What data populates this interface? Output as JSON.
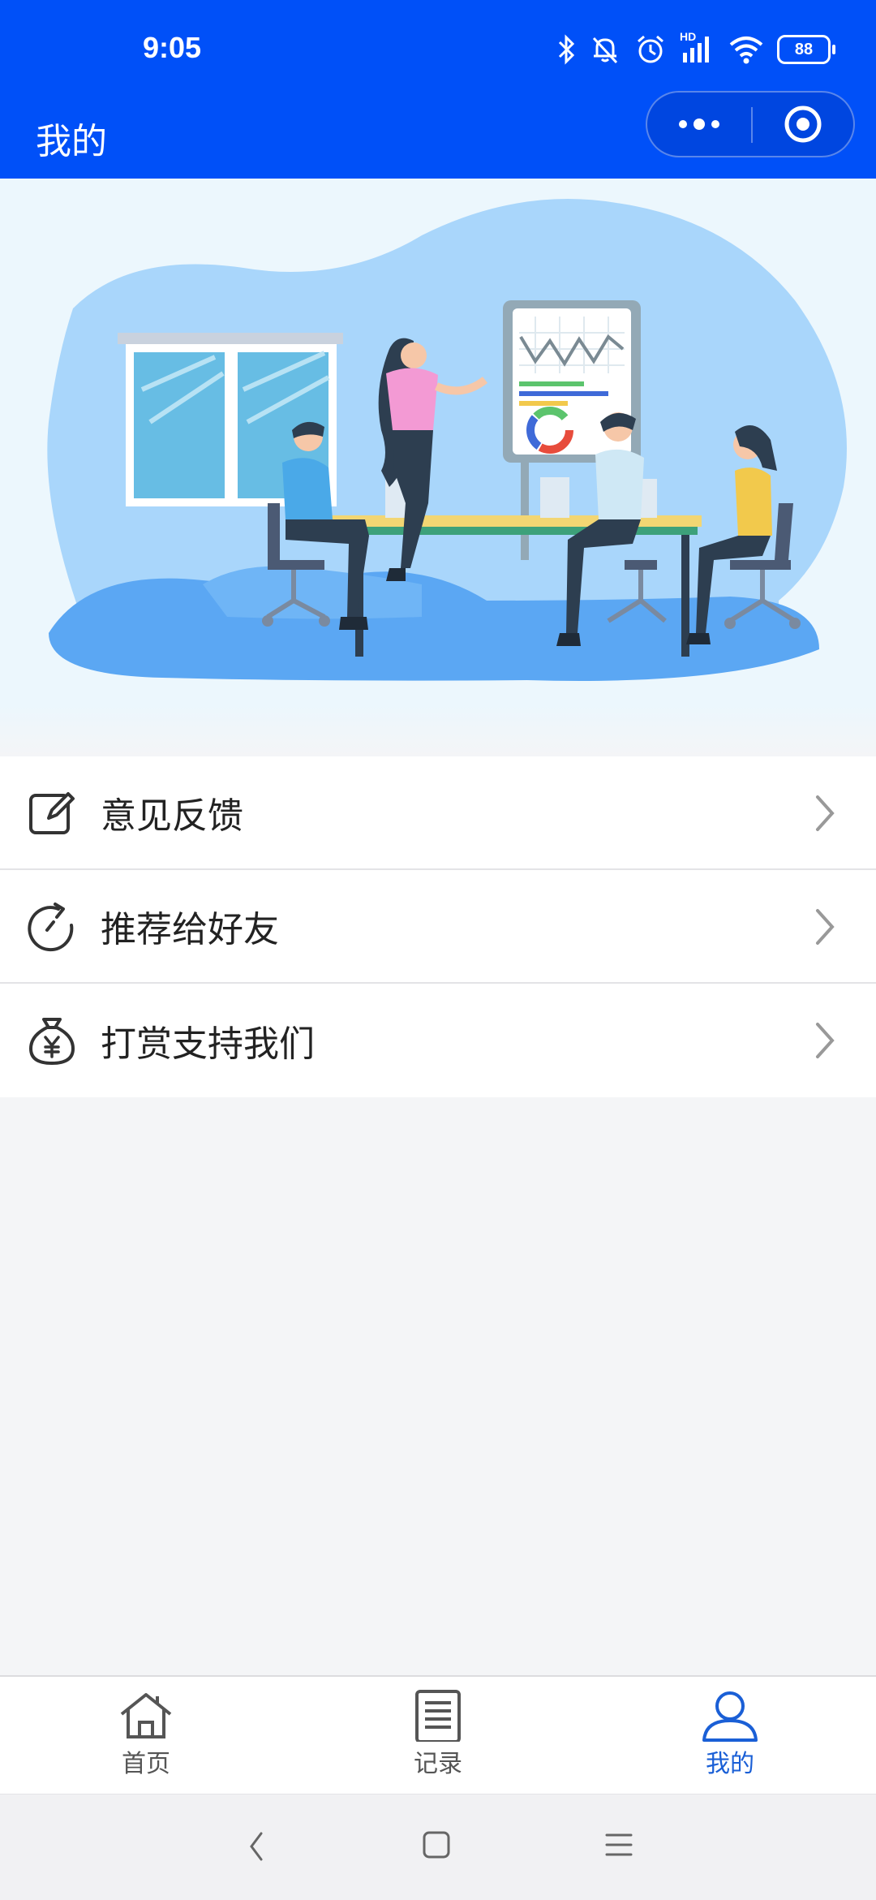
{
  "status_bar": {
    "time": "9:05",
    "battery": "88",
    "network_label": "HD",
    "icons": [
      "bluetooth-icon",
      "bell-off-icon",
      "alarm-icon",
      "signal-icon",
      "wifi-icon",
      "battery-icon"
    ]
  },
  "nav": {
    "title": "我的",
    "capsule_icons": [
      "more-dots-icon",
      "close-target-icon"
    ],
    "accent_color": "#0050f8"
  },
  "banner": {
    "illustration": "team-meeting-illustration"
  },
  "menu": {
    "items": [
      {
        "label": "意见反馈",
        "icon": "edit-icon"
      },
      {
        "label": "推荐给好友",
        "icon": "refresh-share-icon"
      },
      {
        "label": "打赏支持我们",
        "icon": "money-bag-icon"
      }
    ]
  },
  "tabbar": {
    "tabs": [
      {
        "label": "首页",
        "icon": "home-icon",
        "active": false
      },
      {
        "label": "记录",
        "icon": "document-icon",
        "active": false
      },
      {
        "label": "我的",
        "icon": "user-icon",
        "active": true
      }
    ],
    "active_color": "#1a5fd6"
  },
  "system_nav": {
    "buttons": [
      "back-icon",
      "home-square-icon",
      "menu-lines-icon"
    ]
  }
}
